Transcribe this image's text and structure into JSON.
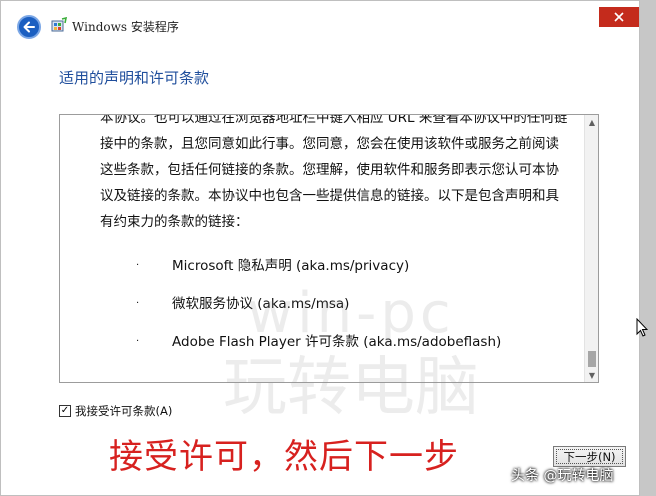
{
  "window": {
    "title": "Windows 安装程序"
  },
  "heading": "适用的声明和许可条款",
  "license": {
    "paragraph": "本协议。也可以通过在浏览器地址栏中键入相应 URL 来查看本协议中的任何链接中的条款，且您同意如此行事。您同意，您会在使用该软件或服务之前阅读这些条款，包括任何链接的条款。您理解，使用软件和服务即表示您认可本协议及链接的条款。本协议中也包含一些提供信息的链接。以下是包含声明和具有约束力的条款的链接：",
    "bullets": [
      "Microsoft 隐私声明 (aka.ms/privacy)",
      "微软服务协议 (aka.ms/msa)",
      "Adobe Flash Player 许可条款 (aka.ms/adobeflash)"
    ],
    "bullet_glyph": "·"
  },
  "accept": {
    "label": "我接受许可条款(A)",
    "checked": true,
    "check_glyph": "✓"
  },
  "annotation": "接受许可，然后下一步",
  "next_button": "下一步(N)",
  "watermark": {
    "line1": "win-pc",
    "line2": "玩转电脑"
  },
  "corner_watermark": "头条 @玩转电脑",
  "colors": {
    "heading": "#1f4e9c",
    "annotation": "#d7211f",
    "back_button": "#1b5fc1",
    "close_button": "#c42b1c"
  },
  "icons": {
    "back": "back-arrow-icon",
    "app": "windows-setup-icon",
    "close": "close-icon"
  }
}
